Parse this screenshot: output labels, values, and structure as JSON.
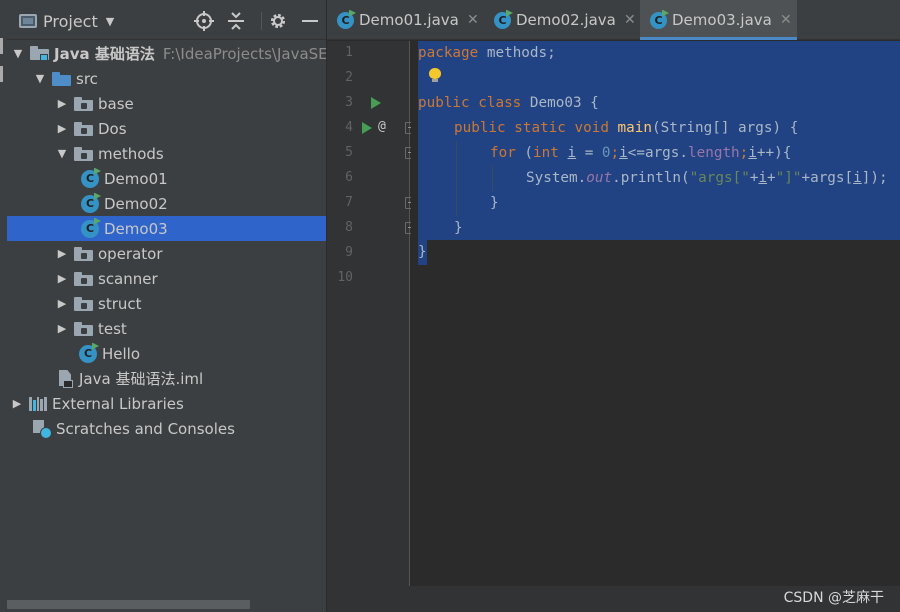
{
  "project_panel": {
    "title": "Project",
    "view_menu_caret": "▼",
    "locate_icon": "crosshair-icon",
    "collapse_icon": "collapse-all-icon",
    "settings_icon": "gear-icon",
    "hide_icon": "minimize-icon"
  },
  "tree": [
    {
      "label": "Java 基础语法",
      "path": "F:\\IdeaProjects\\JavaSE\\",
      "icon": "module-folder-icon",
      "expanded": true
    },
    {
      "label": "src",
      "icon": "source-folder-icon",
      "expanded": true
    },
    {
      "label": "base",
      "icon": "package-folder-icon",
      "expanded": false
    },
    {
      "label": "Dos",
      "icon": "package-folder-icon",
      "expanded": false
    },
    {
      "label": "methods",
      "icon": "package-folder-icon",
      "expanded": true
    },
    {
      "label": "Demo01",
      "icon": "java-class-icon"
    },
    {
      "label": "Demo02",
      "icon": "java-class-icon"
    },
    {
      "label": "Demo03",
      "icon": "java-class-icon",
      "selected": true
    },
    {
      "label": "operator",
      "icon": "package-folder-icon",
      "expanded": false
    },
    {
      "label": "scanner",
      "icon": "package-folder-icon",
      "expanded": false
    },
    {
      "label": "struct",
      "icon": "package-folder-icon",
      "expanded": false
    },
    {
      "label": "test",
      "icon": "package-folder-icon",
      "expanded": false
    },
    {
      "label": "Hello",
      "icon": "java-class-icon"
    },
    {
      "label": "Java 基础语法.iml",
      "icon": "iml-file-icon"
    },
    {
      "label": "External Libraries",
      "icon": "libraries-icon",
      "expanded": false
    },
    {
      "label": "Scratches and Consoles",
      "icon": "scratches-icon"
    }
  ],
  "tabs": [
    {
      "label": "Demo01.java",
      "active": false
    },
    {
      "label": "Demo02.java",
      "active": false
    },
    {
      "label": "Demo03.java",
      "active": true
    }
  ],
  "tab_close_glyph": "✕",
  "class_icon_letter": "C",
  "editor": {
    "line_numbers": [
      "1",
      "2",
      "3",
      "4",
      "5",
      "6",
      "7",
      "8",
      "9",
      "10"
    ],
    "code": {
      "l1_kw": "package",
      "l1_rest": " methods;",
      "l3_kw": "public class",
      "l3_rest": " Demo03 {",
      "l4_kw": "public static void",
      "l4_fn": "main",
      "l4_rest": "(String[] args) {",
      "l5_for": "for",
      "l5_open": " (",
      "l5_int": "int",
      "l5_i1": "i",
      "l5_eq": " = ",
      "l5_zero": "0",
      "l5_semi1": ";",
      "l5_i2": "i",
      "l5_cmp": "<=args.",
      "l5_len": "length",
      "l5_semi2": ";",
      "l5_i3": "i",
      "l5_end": "++){",
      "l6_sys": "System.",
      "l6_out": "out",
      "l6_print": ".println(",
      "l6_s1": "\"args[\"",
      "l6_plus1": "+",
      "l6_i": "i",
      "l6_plus2": "+",
      "l6_s2": "\"]\"",
      "l6_rest1": "+args[",
      "l6_i2": "i",
      "l6_rest2": "]);",
      "l7": "}",
      "l8": "}",
      "l9": "}"
    },
    "at_marker": "@"
  },
  "watermark": "CSDN @芝麻干"
}
